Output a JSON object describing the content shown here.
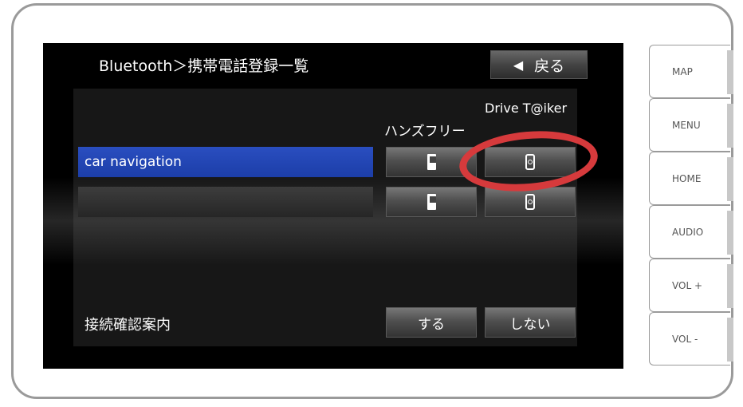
{
  "screen": {
    "title": "Bluetooth＞携帯電話登録一覧",
    "back_button": {
      "icon": "left-triangle-icon",
      "label": "戻る"
    },
    "columns": {
      "handsfree": "ハンズフリー",
      "drive_talker": "Drive T@iker"
    },
    "devices": [
      {
        "name": "car navigation",
        "selected": true,
        "handsfree_icon": "phone-icon",
        "drive_talker_icon": "drive-talker-icon"
      },
      {
        "name": "",
        "selected": false,
        "handsfree_icon": "phone-icon",
        "drive_talker_icon": "drive-talker-icon"
      }
    ],
    "connection_confirm": {
      "label": "接続確認案内",
      "yes": "する",
      "no": "しない"
    }
  },
  "side_buttons": [
    {
      "label": "MAP"
    },
    {
      "label": "MENU"
    },
    {
      "label": "HOME"
    },
    {
      "label": "AUDIO"
    },
    {
      "label": "VOL +"
    },
    {
      "label": "VOL -"
    }
  ],
  "colors": {
    "selected_row": "#1c3ea8",
    "highlight_marker": "#d63a3c"
  }
}
